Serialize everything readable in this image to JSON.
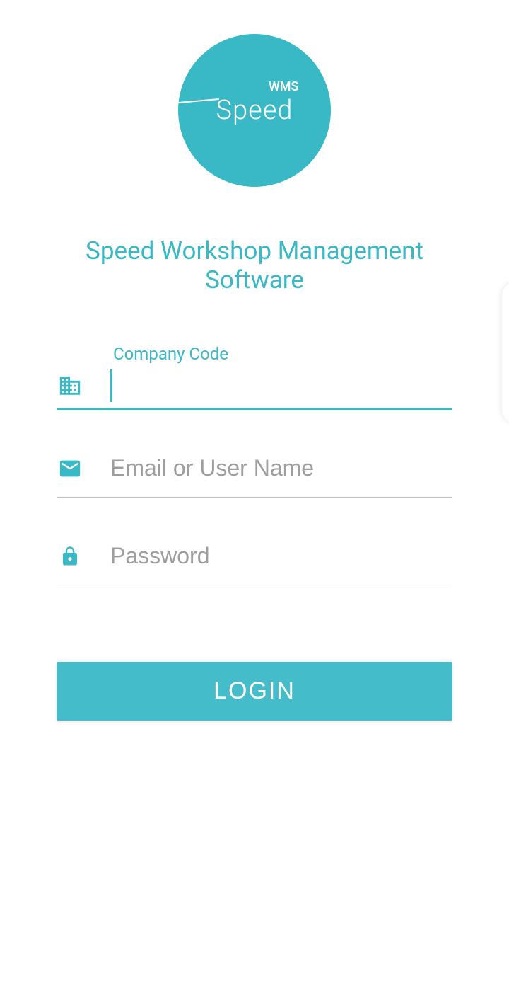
{
  "logo": {
    "brand": "Speed",
    "tag": "WMS"
  },
  "app_title": "Speed Workshop Management Software",
  "fields": {
    "company_code": {
      "label": "Company Code",
      "value": ""
    },
    "username": {
      "placeholder": "Email or User Name",
      "value": ""
    },
    "password": {
      "placeholder": "Password",
      "value": ""
    }
  },
  "login_button": "LOGIN",
  "colors": {
    "accent": "#39b8c6",
    "button": "#45bcc9"
  }
}
